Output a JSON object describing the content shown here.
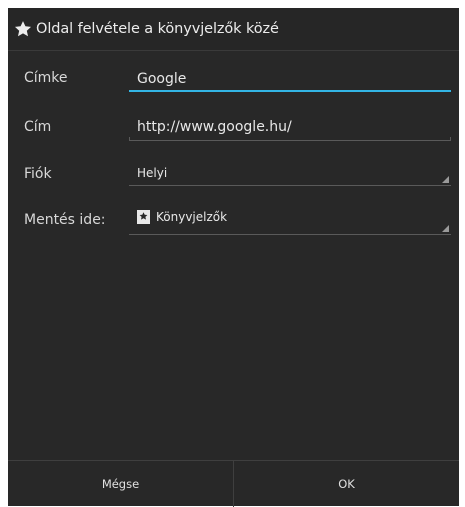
{
  "dialog": {
    "title": "Oldal felvétele a könyvjelzők közé",
    "title_icon": "star-icon"
  },
  "form": {
    "label_field": {
      "label": "Címke",
      "value": "Google",
      "focused": true
    },
    "address_field": {
      "label": "Cím",
      "value": "http://www.google.hu/"
    },
    "account_field": {
      "label": "Fiók",
      "selected": "Helyi"
    },
    "save_to_field": {
      "label": "Mentés ide:",
      "selected": "Könyvjelzők",
      "icon": "bookmark-icon"
    }
  },
  "buttons": {
    "cancel_label": "Mégse",
    "ok_label": "OK"
  },
  "colors": {
    "background": "#282828",
    "accent": "#33b5e5",
    "text": "#e8e8e8"
  }
}
